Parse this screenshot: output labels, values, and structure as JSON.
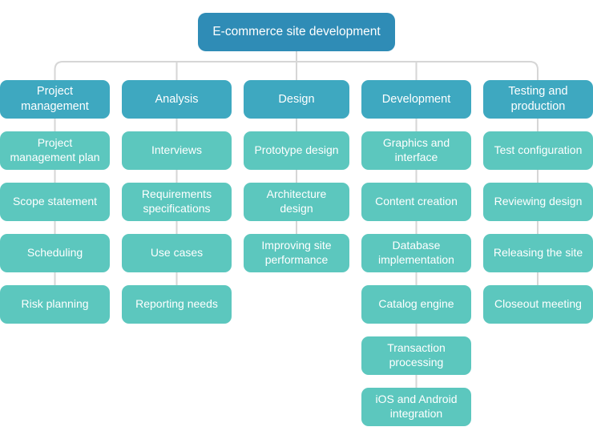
{
  "diagram": {
    "type": "work-breakdown-structure",
    "title": "E-commerce site development",
    "colors": {
      "root": "#2f8cb6",
      "phase": "#3ea8c0",
      "task": "#5cc7be",
      "connector": "#d6d6d6",
      "text": "#ffffff",
      "background": "#ffffff"
    },
    "root": {
      "label": "E-commerce site development"
    },
    "columns": [
      {
        "phase": "Project\nmanagement",
        "tasks": [
          "Project\nmanagement plan",
          "Scope statement",
          "Scheduling",
          "Risk planning"
        ]
      },
      {
        "phase": "Analysis",
        "tasks": [
          "Interviews",
          "Requirements\nspecifications",
          "Use cases",
          "Reporting needs"
        ]
      },
      {
        "phase": "Design",
        "tasks": [
          "Prototype design",
          "Architecture\ndesign",
          "Improving site\nperformance"
        ]
      },
      {
        "phase": "Development",
        "tasks": [
          "Graphics and\ninterface",
          "Content creation",
          "Database\nimplementation",
          "Catalog engine",
          "Transaction\nprocessing",
          "iOS and Android\nintegration"
        ]
      },
      {
        "phase": "Testing and\nproduction",
        "tasks": [
          "Test configuration",
          "Reviewing design",
          "Releasing the site",
          "Closeout meeting"
        ]
      }
    ]
  }
}
